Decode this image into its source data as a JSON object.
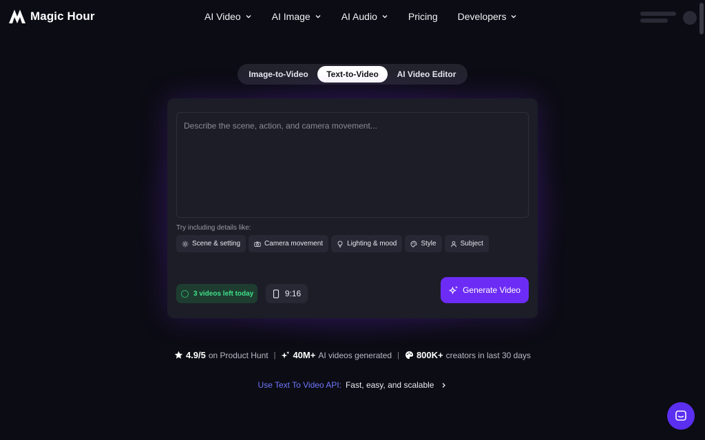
{
  "header": {
    "brand": "Magic Hour",
    "nav": [
      {
        "label": "AI Video",
        "has_dropdown": true
      },
      {
        "label": "AI Image",
        "has_dropdown": true
      },
      {
        "label": "AI Audio",
        "has_dropdown": true
      },
      {
        "label": "Pricing",
        "has_dropdown": false
      },
      {
        "label": "Developers",
        "has_dropdown": true
      }
    ]
  },
  "tabs": [
    {
      "label": "Image-to-Video",
      "active": false
    },
    {
      "label": "Text-to-Video",
      "active": true
    },
    {
      "label": "AI Video Editor",
      "active": false
    }
  ],
  "composer": {
    "placeholder": "Describe the scene, action, and camera movement...",
    "hint": "Try including details like:",
    "chips": [
      {
        "label": "Scene & setting",
        "icon": "sun-icon"
      },
      {
        "label": "Camera movement",
        "icon": "camera-icon"
      },
      {
        "label": "Lighting & mood",
        "icon": "lightbulb-icon"
      },
      {
        "label": "Style",
        "icon": "palette-icon"
      },
      {
        "label": "Subject",
        "icon": "user-icon"
      }
    ],
    "videos_left": "3 videos left today",
    "aspect_ratio": "9:16",
    "generate_label": "Generate Video"
  },
  "stats": {
    "rating_value": "4.9/5",
    "rating_text": "on Product Hunt",
    "videos_value": "40M+",
    "videos_text": "AI videos generated",
    "creators_value": "800K+",
    "creators_text": "creators in last 30 days"
  },
  "api": {
    "link": "Use Text To Video API:",
    "desc": "Fast, easy, and scalable"
  },
  "colors": {
    "background": "#0c0c14",
    "card": "#1c1d27",
    "accent": "#6d2cf5",
    "success": "#3ee089",
    "link": "#6e78ff"
  }
}
